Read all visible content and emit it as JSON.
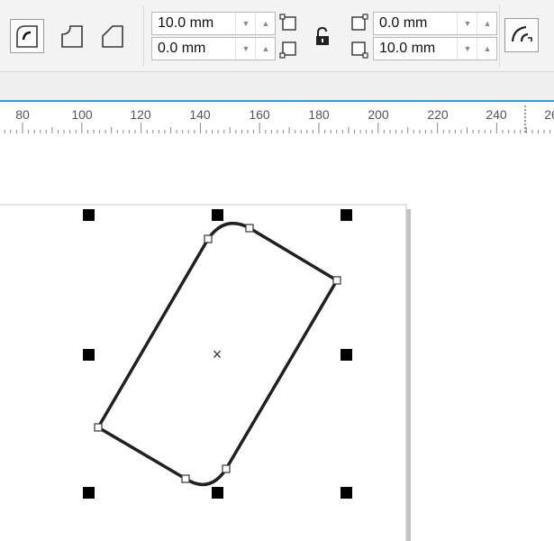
{
  "toolbar": {
    "corner_buttons": [
      {
        "name": "round-corner-button",
        "active": true
      },
      {
        "name": "scalloped-corner-button",
        "active": false
      },
      {
        "name": "chamfered-corner-button",
        "active": false
      }
    ],
    "corner_radius_fields": [
      {
        "name": "corner-radius-top-left",
        "value": "10.0 mm"
      },
      {
        "name": "corner-radius-bottom-left",
        "value": "0.0 mm"
      },
      {
        "name": "corner-radius-top-right",
        "value": "0.0 mm"
      },
      {
        "name": "corner-radius-bottom-right",
        "value": "10.0 mm"
      }
    ],
    "lock_state": "unlocked"
  },
  "ruler": {
    "labels": [
      "80",
      "100",
      "120",
      "140",
      "160",
      "180",
      "200",
      "220",
      "240",
      "26"
    ]
  },
  "colors": {
    "accent": "#2e9fd9",
    "shape_outline": "#231f20",
    "handle": "#000000"
  },
  "canvas": {
    "center_marker": "×"
  }
}
